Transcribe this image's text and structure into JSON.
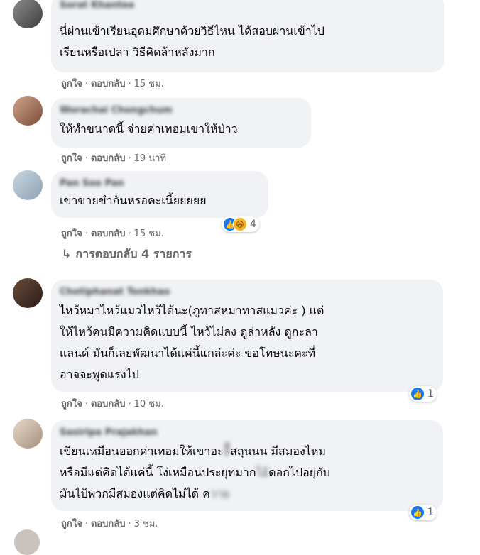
{
  "actions": {
    "like": "ถูกใจ",
    "reply": "ตอบกลับ",
    "separator": "·"
  },
  "comments": [
    {
      "name": "Sorat Khantee",
      "lines": [
        "นี่ผ่านเข้าเรียนอุดมศึกษาด้วยวิธีไหน ได้สอบผ่านเข้าไป",
        "เรียนหรือเปล่า วิธีคิดล้าหลังมาก"
      ],
      "time": "15 ชม."
    },
    {
      "name": "Worachai Chongchum",
      "lines": [
        "ให้ทำขนาดนี้ จ่ายค่าเทอมเขาให้ป่าว"
      ],
      "time": "19 นาที"
    },
    {
      "name": "Pan Soo Pan",
      "lines": [
        "เขาขายขำกันหรอคะเนี้ยยยยย"
      ],
      "time": "15 ชม.",
      "reaction_count": "4"
    },
    {
      "name": "Chotiphanat Tonkhao",
      "lines": [
        "ไหว้หมาไหว้แมวไหว้ได้นะ(ภูทาสหมาทาสแมวค่ะ ) แต่",
        "ให้ไหว้คนมีความคิดแบบนี้ ไหว้ไม่ลง ดูล่าหลัง ดูกะลา",
        "แลนด์ มันก็เลยพัฒนาได้แค่นี้แกล่ะค่ะ ขอโทษนะคะที่",
        "อาจจะพูดแรงไป"
      ],
      "time": "10 ชม.",
      "reaction_count": "1"
    },
    {
      "name": "Sasiripa Prajakhan",
      "line1_a": "เขียนเหมือนออกค่าเทอมให้เขาอะ",
      "line1_b": "ีสถุนนน มีสมองไหม",
      "line2_a": "หรือมีแต่คิดได้แค่นี้ โง่เหมือนประยุทมาก",
      "line2_b": "ดอกไปอยุ่กับ",
      "line3_a": "มันไป้พวกมีสมองแต่คิดไม่ได้ ค",
      "time": "3 ชม.",
      "reaction_count": "1"
    }
  ],
  "more_replies": "การตอบกลับ 4 รายการ",
  "colors": {
    "bubble": "#f0f2f5",
    "meta": "#65676b",
    "like_blue": "#1877f2"
  }
}
